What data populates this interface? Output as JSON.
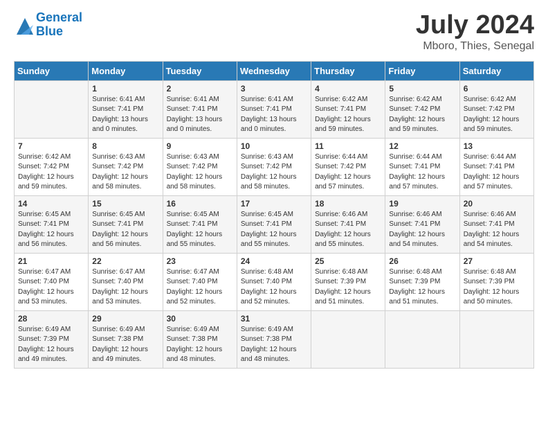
{
  "header": {
    "logo_line1": "General",
    "logo_line2": "Blue",
    "title": "July 2024",
    "subtitle": "Mboro, Thies, Senegal"
  },
  "days_of_week": [
    "Sunday",
    "Monday",
    "Tuesday",
    "Wednesday",
    "Thursday",
    "Friday",
    "Saturday"
  ],
  "weeks": [
    [
      {
        "day": "",
        "sunrise": "",
        "sunset": "",
        "daylight": ""
      },
      {
        "day": "1",
        "sunrise": "6:41 AM",
        "sunset": "7:41 PM",
        "daylight": "13 hours and 0 minutes."
      },
      {
        "day": "2",
        "sunrise": "6:41 AM",
        "sunset": "7:41 PM",
        "daylight": "13 hours and 0 minutes."
      },
      {
        "day": "3",
        "sunrise": "6:41 AM",
        "sunset": "7:41 PM",
        "daylight": "13 hours and 0 minutes."
      },
      {
        "day": "4",
        "sunrise": "6:42 AM",
        "sunset": "7:41 PM",
        "daylight": "12 hours and 59 minutes."
      },
      {
        "day": "5",
        "sunrise": "6:42 AM",
        "sunset": "7:42 PM",
        "daylight": "12 hours and 59 minutes."
      },
      {
        "day": "6",
        "sunrise": "6:42 AM",
        "sunset": "7:42 PM",
        "daylight": "12 hours and 59 minutes."
      }
    ],
    [
      {
        "day": "7",
        "sunrise": "6:42 AM",
        "sunset": "7:42 PM",
        "daylight": "12 hours and 59 minutes."
      },
      {
        "day": "8",
        "sunrise": "6:43 AM",
        "sunset": "7:42 PM",
        "daylight": "12 hours and 58 minutes."
      },
      {
        "day": "9",
        "sunrise": "6:43 AM",
        "sunset": "7:42 PM",
        "daylight": "12 hours and 58 minutes."
      },
      {
        "day": "10",
        "sunrise": "6:43 AM",
        "sunset": "7:42 PM",
        "daylight": "12 hours and 58 minutes."
      },
      {
        "day": "11",
        "sunrise": "6:44 AM",
        "sunset": "7:42 PM",
        "daylight": "12 hours and 57 minutes."
      },
      {
        "day": "12",
        "sunrise": "6:44 AM",
        "sunset": "7:41 PM",
        "daylight": "12 hours and 57 minutes."
      },
      {
        "day": "13",
        "sunrise": "6:44 AM",
        "sunset": "7:41 PM",
        "daylight": "12 hours and 57 minutes."
      }
    ],
    [
      {
        "day": "14",
        "sunrise": "6:45 AM",
        "sunset": "7:41 PM",
        "daylight": "12 hours and 56 minutes."
      },
      {
        "day": "15",
        "sunrise": "6:45 AM",
        "sunset": "7:41 PM",
        "daylight": "12 hours and 56 minutes."
      },
      {
        "day": "16",
        "sunrise": "6:45 AM",
        "sunset": "7:41 PM",
        "daylight": "12 hours and 55 minutes."
      },
      {
        "day": "17",
        "sunrise": "6:45 AM",
        "sunset": "7:41 PM",
        "daylight": "12 hours and 55 minutes."
      },
      {
        "day": "18",
        "sunrise": "6:46 AM",
        "sunset": "7:41 PM",
        "daylight": "12 hours and 55 minutes."
      },
      {
        "day": "19",
        "sunrise": "6:46 AM",
        "sunset": "7:41 PM",
        "daylight": "12 hours and 54 minutes."
      },
      {
        "day": "20",
        "sunrise": "6:46 AM",
        "sunset": "7:41 PM",
        "daylight": "12 hours and 54 minutes."
      }
    ],
    [
      {
        "day": "21",
        "sunrise": "6:47 AM",
        "sunset": "7:40 PM",
        "daylight": "12 hours and 53 minutes."
      },
      {
        "day": "22",
        "sunrise": "6:47 AM",
        "sunset": "7:40 PM",
        "daylight": "12 hours and 53 minutes."
      },
      {
        "day": "23",
        "sunrise": "6:47 AM",
        "sunset": "7:40 PM",
        "daylight": "12 hours and 52 minutes."
      },
      {
        "day": "24",
        "sunrise": "6:48 AM",
        "sunset": "7:40 PM",
        "daylight": "12 hours and 52 minutes."
      },
      {
        "day": "25",
        "sunrise": "6:48 AM",
        "sunset": "7:39 PM",
        "daylight": "12 hours and 51 minutes."
      },
      {
        "day": "26",
        "sunrise": "6:48 AM",
        "sunset": "7:39 PM",
        "daylight": "12 hours and 51 minutes."
      },
      {
        "day": "27",
        "sunrise": "6:48 AM",
        "sunset": "7:39 PM",
        "daylight": "12 hours and 50 minutes."
      }
    ],
    [
      {
        "day": "28",
        "sunrise": "6:49 AM",
        "sunset": "7:39 PM",
        "daylight": "12 hours and 49 minutes."
      },
      {
        "day": "29",
        "sunrise": "6:49 AM",
        "sunset": "7:38 PM",
        "daylight": "12 hours and 49 minutes."
      },
      {
        "day": "30",
        "sunrise": "6:49 AM",
        "sunset": "7:38 PM",
        "daylight": "12 hours and 48 minutes."
      },
      {
        "day": "31",
        "sunrise": "6:49 AM",
        "sunset": "7:38 PM",
        "daylight": "12 hours and 48 minutes."
      },
      {
        "day": "",
        "sunrise": "",
        "sunset": "",
        "daylight": ""
      },
      {
        "day": "",
        "sunrise": "",
        "sunset": "",
        "daylight": ""
      },
      {
        "day": "",
        "sunrise": "",
        "sunset": "",
        "daylight": ""
      }
    ]
  ]
}
